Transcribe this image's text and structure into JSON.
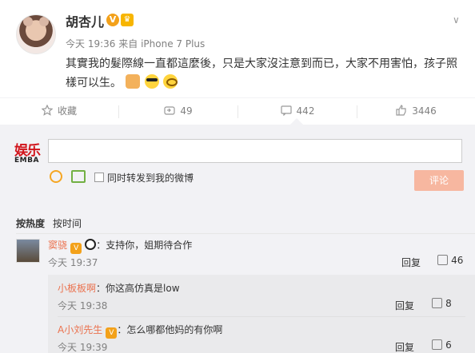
{
  "post": {
    "username": "胡杏儿",
    "time": "今天 19:36",
    "source_prefix": "来自",
    "device": "iPhone 7 Plus",
    "text": "其實我的髮際線一直都這麼後，只是大家沒注意到而已，大家不用害怕，孩子照樣可以生。",
    "actions": {
      "favorite": "收藏",
      "forward": "49",
      "comment": "442",
      "like": "3446"
    }
  },
  "comment_box": {
    "brand_top": "娱乐",
    "brand_bottom": "EMBA",
    "checkbox_label": "同时转发到我的微博",
    "submit": "评论"
  },
  "sort": {
    "hot": "按热度",
    "time": "按时间"
  },
  "comments": [
    {
      "name": "窦骁",
      "text": "：支持你，姐期待合作",
      "time": "今天 19:37",
      "reply": "回复",
      "likes": "46"
    },
    {
      "name": "小板板啊",
      "text": "：你这高仿真是low",
      "time": "今天 19:38",
      "reply": "回复",
      "likes": "8"
    },
    {
      "name": "A小刘先生",
      "text": "：怎么哪都他妈的有你啊",
      "time": "今天 19:39",
      "reply": "回复",
      "likes": "6"
    }
  ],
  "colors": {
    "accent": "#eb7350",
    "comments_bg": "#f2f2f5"
  }
}
